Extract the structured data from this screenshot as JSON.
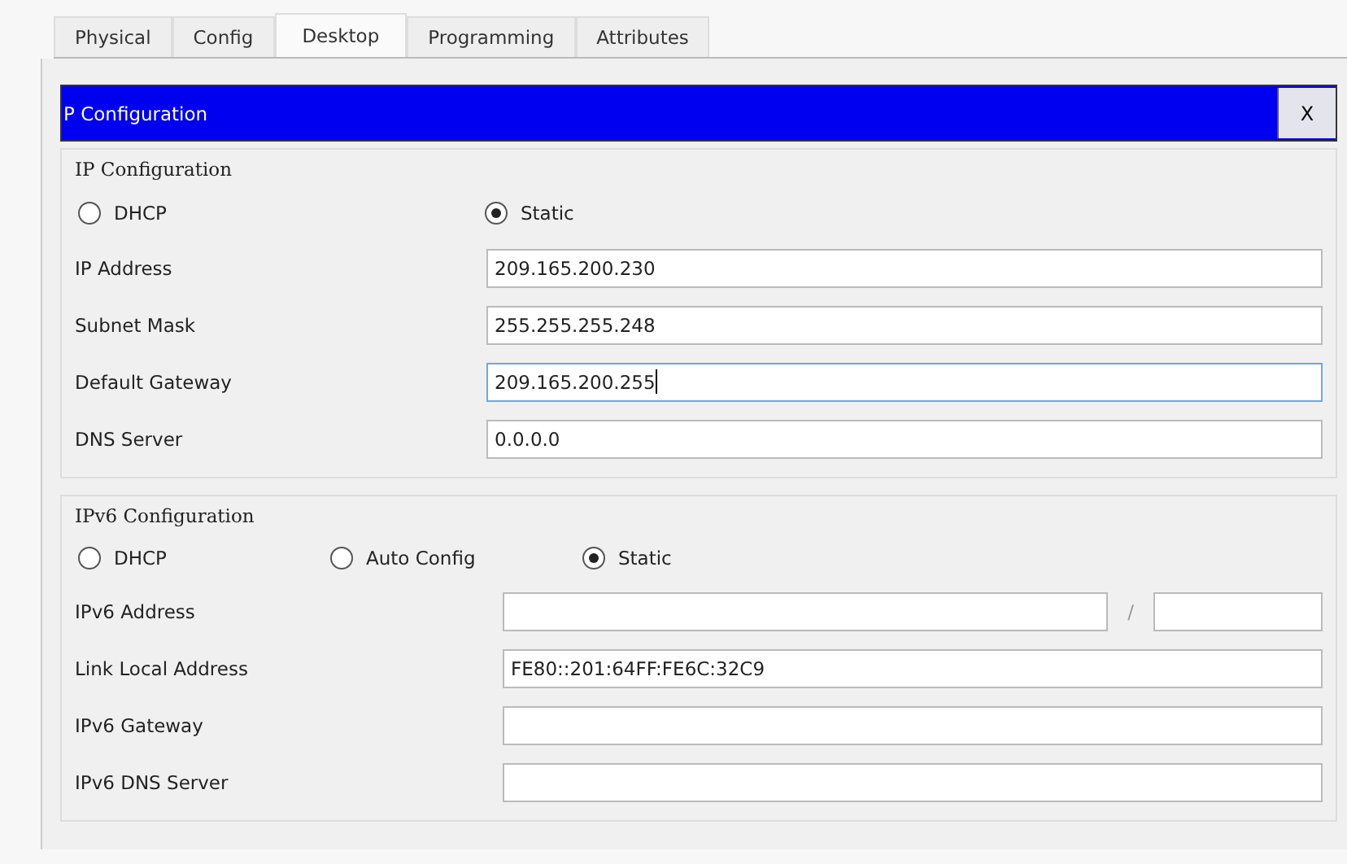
{
  "tabs": [
    {
      "label": "Physical",
      "selected": false
    },
    {
      "label": "Config",
      "selected": false
    },
    {
      "label": "Desktop",
      "selected": true
    },
    {
      "label": "Programming",
      "selected": false
    },
    {
      "label": "Attributes",
      "selected": false
    }
  ],
  "dialog": {
    "title": "P Configuration",
    "close": "X"
  },
  "ipv4": {
    "legend": "IP Configuration",
    "modes": [
      {
        "label": "DHCP",
        "selected": false
      },
      {
        "label": "Static",
        "selected": true
      }
    ],
    "fields": [
      {
        "label": "IP Address",
        "value": "209.165.200.230",
        "focused": false
      },
      {
        "label": "Subnet Mask",
        "value": "255.255.255.248",
        "focused": false
      },
      {
        "label": "Default Gateway",
        "value": "209.165.200.255",
        "focused": true
      },
      {
        "label": "DNS Server",
        "value": "0.0.0.0",
        "focused": false
      }
    ]
  },
  "ipv6": {
    "legend": "IPv6 Configuration",
    "modes": [
      {
        "label": "DHCP",
        "selected": false
      },
      {
        "label": "Auto Config",
        "selected": false
      },
      {
        "label": "Static",
        "selected": true
      }
    ],
    "fields": [
      {
        "kind": "prefixed",
        "label": "IPv6 Address",
        "separator": "/"
      },
      {
        "kind": "plain",
        "label": "Link Local Address",
        "value": "FE80::201:64FF:FE6C:32C9"
      },
      {
        "kind": "plain",
        "label": "IPv6 Gateway"
      },
      {
        "kind": "plain",
        "label": "IPv6 DNS Server"
      }
    ]
  }
}
